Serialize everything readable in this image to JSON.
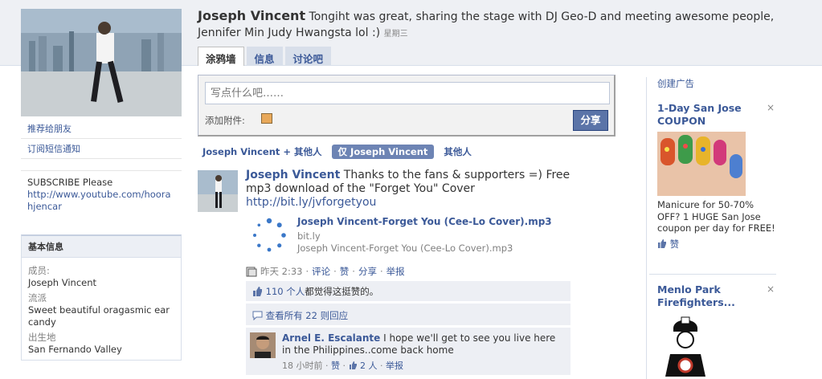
{
  "profile": {
    "name": "Joseph Vincent",
    "status": "Tongiht was great, sharing the stage with DJ Geo-D and meeting awesome people, Jennifer Min Judy Hwangsta lol :)",
    "status_time": "星期三"
  },
  "tabs": [
    {
      "label": "涂鸦墙",
      "active": true
    },
    {
      "label": "信息",
      "active": false
    },
    {
      "label": "讨论吧",
      "active": false
    }
  ],
  "sidebar": {
    "suggest": "推荐给朋友",
    "sms": "订阅短信通知",
    "bio_text": "SUBSCRIBE Please",
    "bio_link": "http://www.youtube.com/hoorahjencar",
    "info_title": "基本信息",
    "fields": [
      {
        "label": "成员:",
        "value": "Joseph Vincent"
      },
      {
        "label": "流派",
        "value": "Sweet beautiful oragasmic ear candy"
      },
      {
        "label": "出生地",
        "value": "San Fernando Valley"
      }
    ]
  },
  "publisher": {
    "placeholder": "写点什么吧……",
    "attach_label": "添加附件:",
    "share_label": "分享"
  },
  "filters": [
    "Joseph Vincent + 其他人",
    "仅 Joseph Vincent",
    "其他人"
  ],
  "story": {
    "author": "Joseph Vincent",
    "text": "Thanks to the fans & supporters =) Free mp3 download of the \"Forget You\" Cover",
    "link": "http://bit.ly/jvforgetyou",
    "attachment": {
      "title": "Joseph Vincent-Forget You (Cee-Lo Cover).mp3",
      "source": "bit.ly",
      "desc": "Joseph Vincent-Forget You (Cee-Lo Cover).mp3"
    },
    "meta": {
      "time": "昨天 2:33",
      "comment": "评论",
      "like": "赞",
      "share": "分享",
      "report": "举报",
      "sep": "·"
    },
    "likes_count": "110 个人",
    "likes_suffix": "都觉得这挺赞的。",
    "view_all": "查看所有 22 则回应",
    "comment": {
      "author": "Arnel E. Escalante",
      "text": "I hope we'll get to see you live here in the Philippines..come back home",
      "time": "18 小时前",
      "like": "赞",
      "count": "2 人",
      "report": "举报"
    }
  },
  "ads": {
    "create": "创建广告",
    "items": [
      {
        "title": "1-Day San Jose COUPON",
        "body": "Manicure for 50-70% OFF? 1 HUGE San Jose coupon per day for FREE!",
        "like": "赞",
        "close": "×"
      },
      {
        "title": "Menlo Park Firefighters...",
        "close": "×"
      }
    ]
  },
  "colors": {
    "link": "#3b5998",
    "button": "#5b74a8",
    "header_bg": "#eef0f4"
  }
}
